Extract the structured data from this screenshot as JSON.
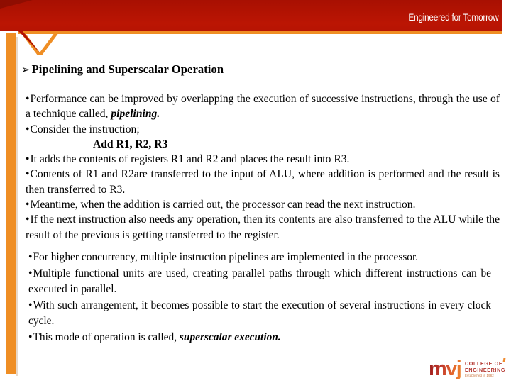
{
  "header": {
    "tagline": "Engineered for Tomorrow",
    "red": "#b81403",
    "orange": "#ef8e24"
  },
  "heading": {
    "bullet": "➢",
    "text": "Pipelining and Superscalar Operation"
  },
  "block1": {
    "lines": [
      {
        "bullet": "•",
        "parts": [
          {
            "text": "Performance can be improved by overlapping the execution of successive instructions, through the use of a technique called, ",
            "style": "normal"
          },
          {
            "text": "pipelining.",
            "style": "bold-italic"
          }
        ]
      },
      {
        "bullet": "•",
        "parts": [
          {
            "text": "Consider the instruction;",
            "style": "normal"
          }
        ]
      },
      {
        "bullet": "",
        "indent": true,
        "parts": [
          {
            "text": "Add R1, R2, R3",
            "style": "bold"
          }
        ]
      },
      {
        "bullet": "•",
        "parts": [
          {
            "text": "It adds the contents of registers R1 and R2 and places the result into R3.",
            "style": "normal"
          }
        ]
      },
      {
        "bullet": "•",
        "parts": [
          {
            "text": "Contents of R1 and R2are transferred to the input of ALU, where addition is performed and the result is then transferred to R3.",
            "style": "normal"
          }
        ]
      },
      {
        "bullet": "•",
        "parts": [
          {
            "text": "Meantime, when the addition is carried out, the processor can read the next instruction.",
            "style": "normal"
          }
        ]
      },
      {
        "bullet": "•",
        "parts": [
          {
            "text": "If the next instruction also needs any operation, then its contents are also transferred to the ALU while the result of the previous is getting transferred to the register.",
            "style": "normal"
          }
        ]
      }
    ]
  },
  "block2": {
    "lines": [
      {
        "bullet": "•",
        "parts": [
          {
            "text": "For higher concurrency, multiple instruction pipelines are implemented in the processor.",
            "style": "normal"
          }
        ]
      },
      {
        "bullet": "•",
        "parts": [
          {
            "text": "Multiple functional units are used, creating parallel paths through which different instructions can be executed in parallel.",
            "style": "normal"
          }
        ]
      },
      {
        "bullet": "•",
        "parts": [
          {
            "text": "With such arrangement, it becomes possible to start the execution of several instructions in every clock cycle.",
            "style": "normal"
          }
        ]
      },
      {
        "bullet": "•",
        "parts": [
          {
            "text": "This mode of operation is called, ",
            "style": "normal"
          },
          {
            "text": "superscalar execution.",
            "style": "bold-italic"
          }
        ]
      }
    ]
  },
  "logo": {
    "mark": "mvj",
    "line1": "COLLEGE OF",
    "line2": "ENGINEERING",
    "line3": "Established in 1982"
  }
}
